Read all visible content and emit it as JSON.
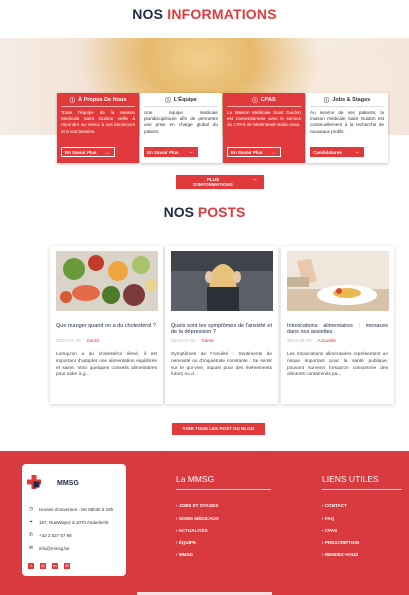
{
  "header": {
    "title_part1": "NOS",
    "title_part2": "INFORMATIONS"
  },
  "cards": [
    {
      "title": "À Propos De Nous",
      "icon": "info-circle-icon",
      "style": "red",
      "text": "Toute l'équipe de la Maison Médicale Saint Guidon veille à répondre au mieux à vos bsoinnces et à vos besoins.",
      "button": "En Savoir Plus"
    },
    {
      "title": "L'Équipe",
      "icon": "info-circle-icon",
      "style": "white",
      "text": "Une équipe médicale pluridisciplinaire afin de permettre une prise en charge global du patient.",
      "button": "En Savoir Plus"
    },
    {
      "title": "CPAS",
      "icon": "info-circle-icon",
      "style": "red",
      "text": "La Maison Médicale Saint Guidon est conventionnée avec le service du CPAS de Molenbeek-Saint-Jean.",
      "button": "En Savoir Plus"
    },
    {
      "title": "Jobs & Stages",
      "icon": "info-circle-icon",
      "style": "white",
      "text": "Au service de ses patients, la maison médicale Saint Guidon est continuellement à la recherche de nouveaux profils.",
      "button": "Candidatures"
    }
  ],
  "more_info_label": "PLUS D'INFORMATIONS",
  "posts_header": {
    "part1": "NOS",
    "part2": "POSTS"
  },
  "posts": [
    {
      "title": "Que manger quand on a du cholestérol ?",
      "date": "2024-07-30",
      "category": "Santé",
      "excerpt": "Lorsqu'on a du cholestérol élevé, il est important d'adopter une alimentation équilibrée et saine. Voici quelques conseils alimentaires pour aider à g...",
      "image": "healthy-food-image"
    },
    {
      "title": "Quels sont les symptômes de l'anxiété et de la dépression ?",
      "date": "2024-07-30",
      "category": "Santé",
      "excerpt": "Symptômes de l'Anxiété : Sentiments de nervosité ou d'inquiétude constante : Se sentir sur le qui-vive, inquiet pour des événements futurs ou d...",
      "image": "anxious-woman-image"
    },
    {
      "title": "Intoxications alimentaires : menaces dans nos assiettes",
      "date": "2024-06-03",
      "category": "Actualité",
      "excerpt": "Les intoxications alimentaires représentent un risque important pour la santé publique, pouvant survenir lorsqu'on consomme des aliments contaminés pa...",
      "image": "refusing-plate-image"
    }
  ],
  "all_posts_label": "VOIR TOUS LES POST DU BLOG",
  "footer": {
    "brand": "MMSG",
    "hours": "Horaire d'ouverture : De 08h30 à 18h",
    "address": "167, RueWayez à 1070 Anderlecht",
    "phone": "+32 2 527 67 98",
    "email": "info@mmsg.be",
    "col1_title": "La MMSG",
    "col1_links": [
      "JOBS ET STAGES",
      "SOINS MÉDICAUX",
      "ACTUALITÉS",
      "ÉQUIPE",
      "MMSG"
    ],
    "col2_title": "LIENS UTILES",
    "col2_links": [
      "CONTACT",
      "FAQ",
      "CPAS",
      "PRESCRIPTION",
      "RENDEZ-VOUS"
    ],
    "socials": [
      "facebook-icon",
      "instagram-icon",
      "linkedin-icon",
      "mail-icon"
    ]
  },
  "colors": {
    "accent": "#e03a3c",
    "navy": "#1f2a44",
    "footer_bg": "#d93a3f"
  }
}
